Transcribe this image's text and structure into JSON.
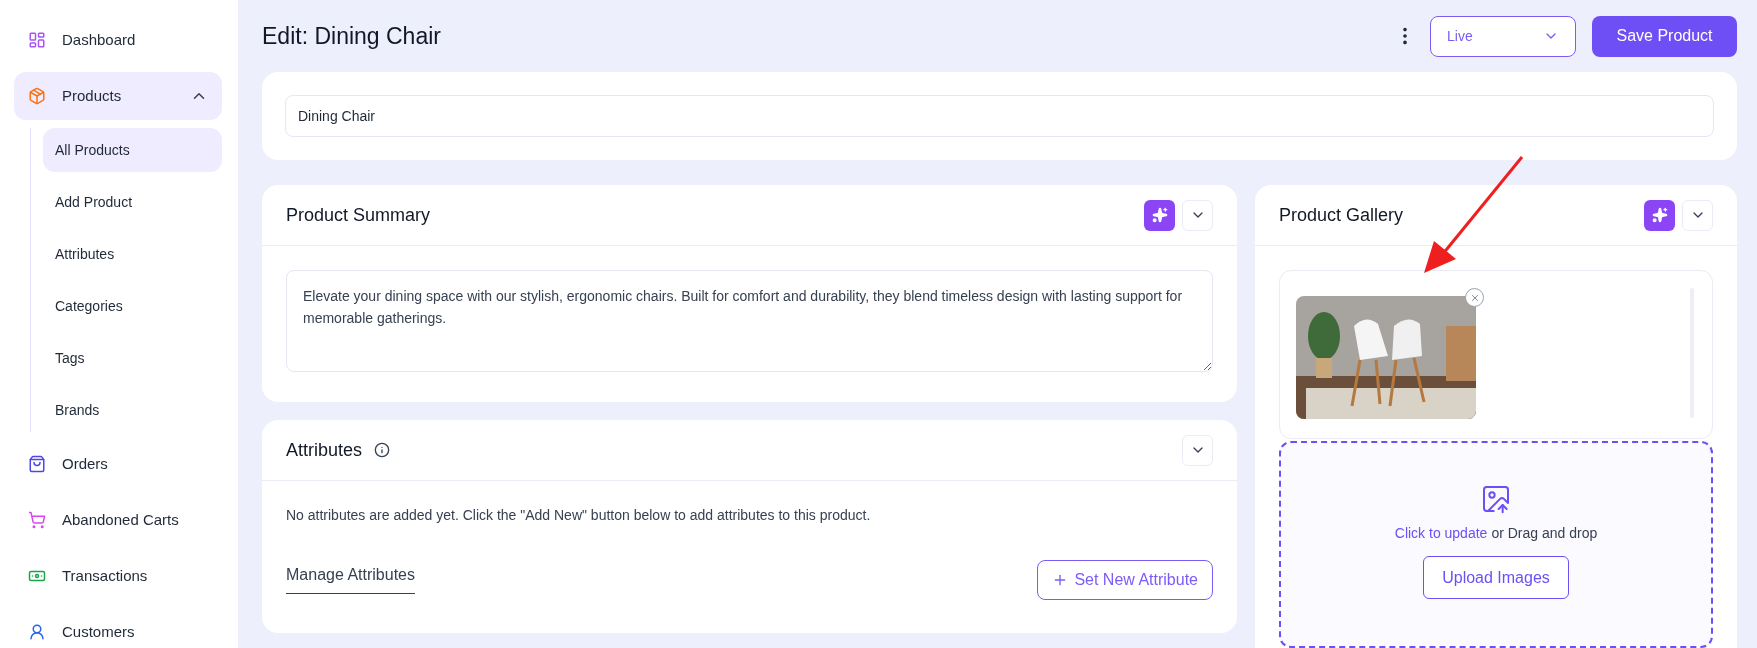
{
  "sidebar": {
    "items": [
      {
        "label": "Dashboard",
        "kind": "dashboard",
        "selected": false
      },
      {
        "label": "Products",
        "kind": "products",
        "selected": true,
        "expanded": true,
        "children": [
          {
            "label": "All Products",
            "selected": true
          },
          {
            "label": "Add Product",
            "selected": false
          },
          {
            "label": "Attributes",
            "selected": false
          },
          {
            "label": "Categories",
            "selected": false
          },
          {
            "label": "Tags",
            "selected": false
          },
          {
            "label": "Brands",
            "selected": false
          }
        ]
      },
      {
        "label": "Orders",
        "kind": "orders",
        "selected": false
      },
      {
        "label": "Abandoned Carts",
        "kind": "carts",
        "selected": false
      },
      {
        "label": "Transactions",
        "kind": "transactions",
        "selected": false
      },
      {
        "label": "Customers",
        "kind": "customers",
        "selected": false
      }
    ]
  },
  "header": {
    "title": "Edit: Dining Chair",
    "status": "Live",
    "save_button": "Save Product"
  },
  "name_field": {
    "value": "Dining Chair"
  },
  "summary": {
    "title": "Product Summary",
    "text": "Elevate your dining space with our stylish, ergonomic chairs. Built for comfort and durability, they blend timeless design with lasting support for memorable gatherings."
  },
  "attributes": {
    "title": "Attributes",
    "empty_message": "No attributes are added yet. Click the \"Add New\" button below to add attributes to this product.",
    "tabs": [
      {
        "label": "Manage Attributes",
        "selected": true
      }
    ],
    "add_button": "Set New Attribute"
  },
  "gallery": {
    "title": "Product Gallery",
    "upload_link": "Click to update",
    "upload_text": "or Drag and drop",
    "upload_button": "Upload Images"
  }
}
